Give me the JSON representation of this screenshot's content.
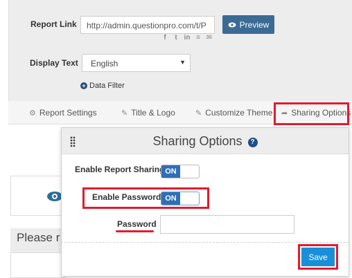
{
  "report_panel": {
    "report_link_label": "Report Link",
    "report_link_value": "http://admin.questionpro.com/t/P",
    "preview_label": "Preview",
    "social_icons": [
      "facebook-icon",
      "twitter-icon",
      "linkedin-icon",
      "share-icon",
      "email-icon"
    ],
    "display_text_label": "Display Text",
    "display_text_value": "English",
    "data_filter_label": "Data Filter"
  },
  "tabs": [
    {
      "label": "Report Settings",
      "icon": "gears-icon"
    },
    {
      "label": "Title & Logo",
      "icon": "edit-icon"
    },
    {
      "label": "Customize Theme",
      "icon": "edit-icon"
    },
    {
      "label": "Sharing Options",
      "icon": "share-arrow-icon"
    }
  ],
  "background": {
    "please_text": "Please r"
  },
  "modal": {
    "title": "Sharing Options",
    "enable_report_sharing_label": "Enable Report Sharing",
    "enable_report_sharing_state": "ON",
    "enable_password_label": "Enable Password",
    "enable_password_state": "ON",
    "password_label": "Password",
    "password_value": "",
    "save_label": "Save"
  },
  "colors": {
    "accent_blue": "#2e6fb6",
    "preview_button": "#3b6a95",
    "save_button": "#1a8fd9",
    "highlight_red": "#e21b2e"
  }
}
